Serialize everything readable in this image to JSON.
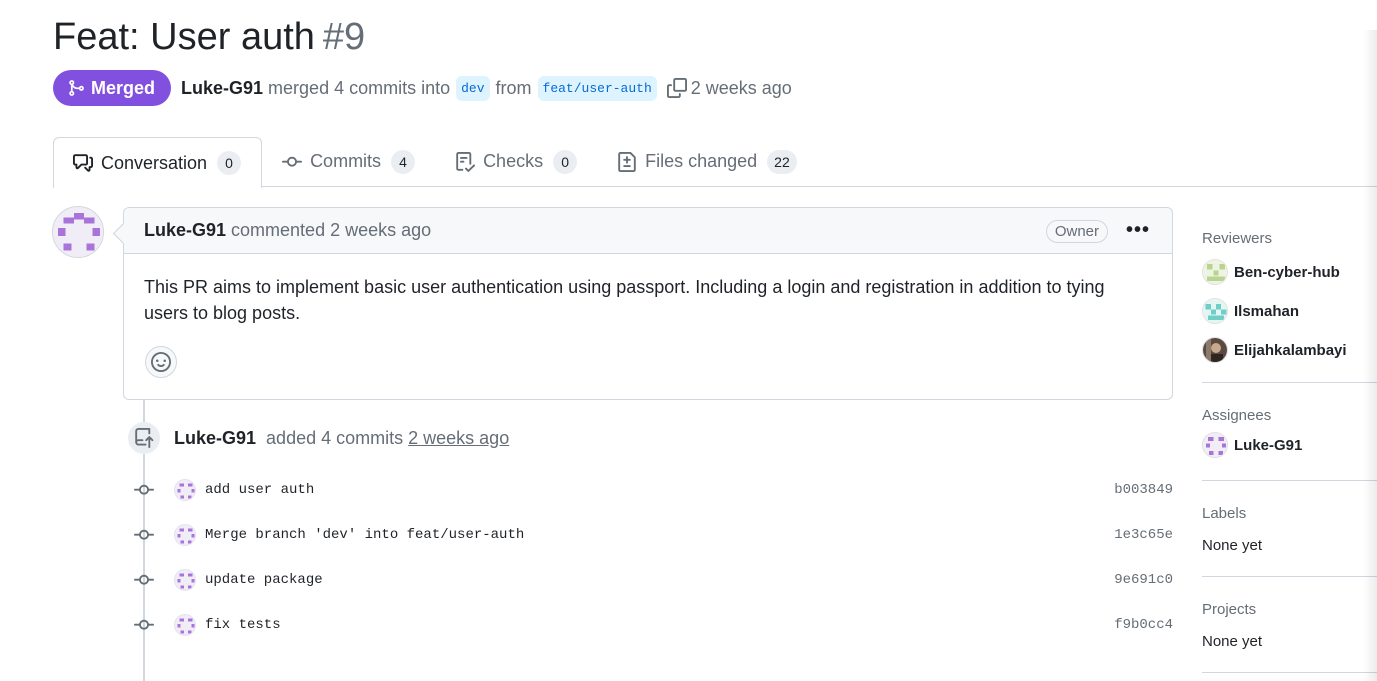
{
  "pr": {
    "title": "Feat: User auth",
    "number": "#9",
    "status": "Merged",
    "author": "Luke-G91",
    "merge_text": "merged 4 commits into",
    "base_branch": "dev",
    "from_text": "from",
    "head_branch": "feat/user-auth",
    "time": "2 weeks ago"
  },
  "tabs": [
    {
      "label": "Conversation",
      "count": "0",
      "icon": "comment-discussion-icon"
    },
    {
      "label": "Commits",
      "count": "4",
      "icon": "git-commit-icon"
    },
    {
      "label": "Checks",
      "count": "0",
      "icon": "checklist-icon"
    },
    {
      "label": "Files changed",
      "count": "22",
      "icon": "file-diff-icon"
    }
  ],
  "comment": {
    "author": "Luke-G91",
    "action": "commented 2 weeks ago",
    "badge": "Owner",
    "more": "•••",
    "body": "This PR aims to implement basic user authentication using passport. Including a login and registration in addition to tying users to blog posts."
  },
  "event": {
    "author": "Luke-G91",
    "action": "added 4 commits",
    "time": "2 weeks ago"
  },
  "commits": [
    {
      "message": "add user auth",
      "sha": "b003849"
    },
    {
      "message": "Merge branch 'dev' into feat/user-auth",
      "sha": "1e3c65e"
    },
    {
      "message": "update package",
      "sha": "9e691c0"
    },
    {
      "message": "fix tests",
      "sha": "f9b0cc4"
    }
  ],
  "sidebar": {
    "reviewers_heading": "Reviewers",
    "reviewers": [
      "Ben-cyber-hub",
      "Ilsmahan",
      "Elijahkalambayi"
    ],
    "assignees_heading": "Assignees",
    "assignees": [
      "Luke-G91"
    ],
    "labels_heading": "Labels",
    "labels_value": "None yet",
    "projects_heading": "Projects",
    "projects_value": "None yet"
  },
  "colors": {
    "merged": "#8250df",
    "branch_bg": "#ddf4ff",
    "branch_fg": "#0969da",
    "muted": "#656d76",
    "border": "#d0d7de"
  }
}
